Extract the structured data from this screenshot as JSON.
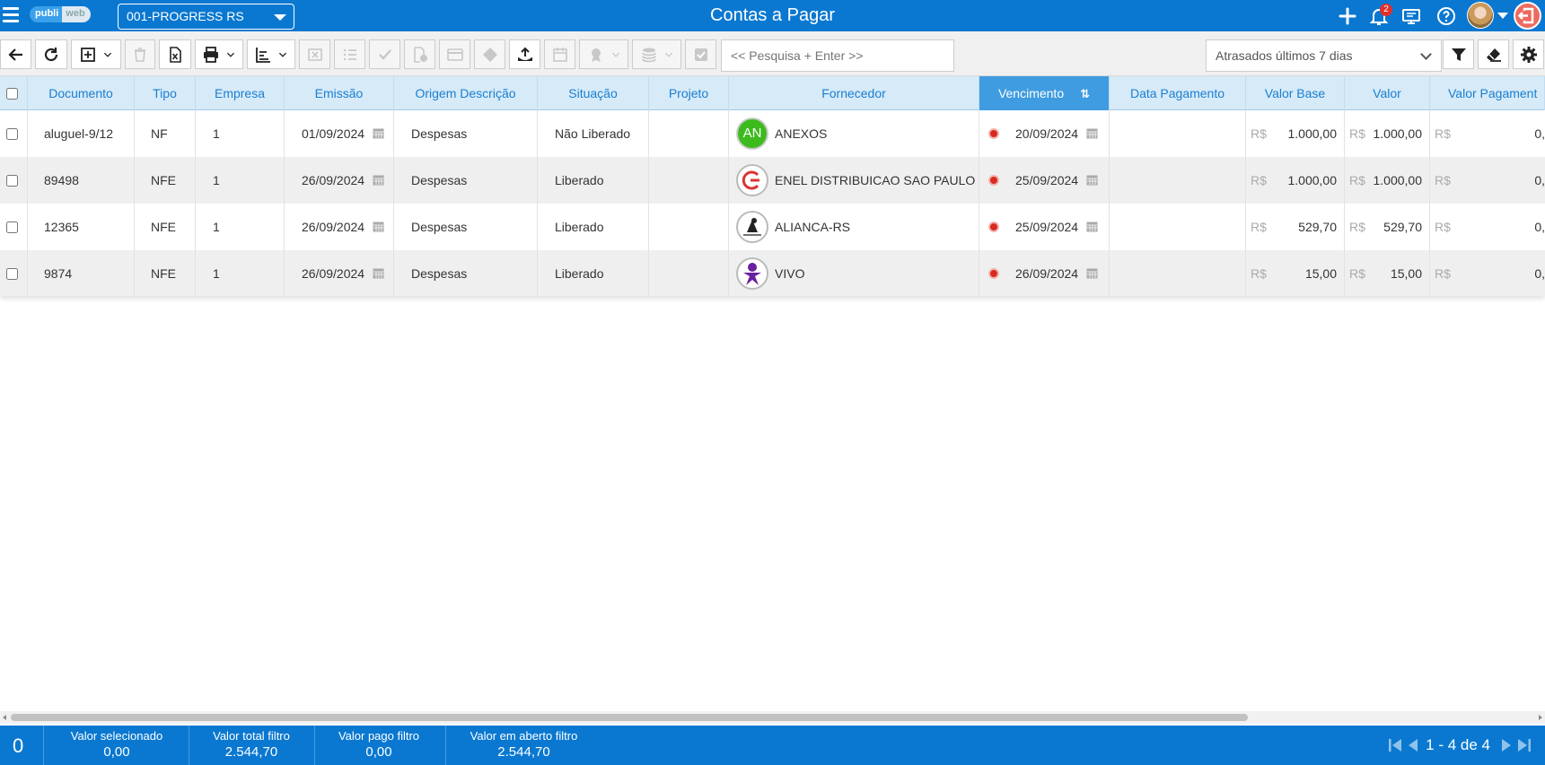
{
  "header": {
    "company": "001-PROGRESS RS",
    "title": "Contas a Pagar",
    "notification_count": "2",
    "logo": {
      "part1": "publi",
      "part2": "web"
    }
  },
  "toolbar": {
    "search_placeholder": "<< Pesquisa + Enter >>",
    "filter_value": "Atrasados últimos 7 dias"
  },
  "grid": {
    "columns": {
      "documento": "Documento",
      "tipo": "Tipo",
      "empresa": "Empresa",
      "emissao": "Emissão",
      "origem": "Origem Descrição",
      "situacao": "Situação",
      "projeto": "Projeto",
      "fornecedor": "Fornecedor",
      "vencimento": "Vencimento",
      "data_pagamento": "Data Pagamento",
      "valor_base": "Valor Base",
      "valor": "Valor",
      "valor_pagamento": "Valor Pagament"
    },
    "currency": "R$",
    "rows": [
      {
        "documento": "aluguel-9/12",
        "tipo": "NF",
        "empresa": "1",
        "emissao": "01/09/2024",
        "origem": "Despesas",
        "situacao": "Não Liberado",
        "projeto": "",
        "fornecedor_initials": "AN",
        "fornecedor": "ANEXOS",
        "vencimento": "20/09/2024",
        "data_pagamento": "",
        "valor_base": "1.000,00",
        "valor": "1.000,00",
        "valor_pagamento": "0,"
      },
      {
        "documento": "89498",
        "tipo": "NFE",
        "empresa": "1",
        "emissao": "26/09/2024",
        "origem": "Despesas",
        "situacao": "Liberado",
        "projeto": "",
        "fornecedor_initials": "",
        "fornecedor": "ENEL DISTRIBUICAO SAO PAULO",
        "vencimento": "25/09/2024",
        "data_pagamento": "",
        "valor_base": "1.000,00",
        "valor": "1.000,00",
        "valor_pagamento": "0,"
      },
      {
        "documento": "12365",
        "tipo": "NFE",
        "empresa": "1",
        "emissao": "26/09/2024",
        "origem": "Despesas",
        "situacao": "Liberado",
        "projeto": "",
        "fornecedor_initials": "",
        "fornecedor": "ALIANCA-RS",
        "vencimento": "25/09/2024",
        "data_pagamento": "",
        "valor_base": "529,70",
        "valor": "529,70",
        "valor_pagamento": "0,"
      },
      {
        "documento": "9874",
        "tipo": "NFE",
        "empresa": "1",
        "emissao": "26/09/2024",
        "origem": "Despesas",
        "situacao": "Liberado",
        "projeto": "",
        "fornecedor_initials": "",
        "fornecedor": "VIVO",
        "vencimento": "26/09/2024",
        "data_pagamento": "",
        "valor_base": "15,00",
        "valor": "15,00",
        "valor_pagamento": "0,"
      }
    ]
  },
  "footer": {
    "selected_count": "0",
    "valor_selecionado_label": "Valor selecionado",
    "valor_selecionado": "0,00",
    "valor_total_label": "Valor total filtro",
    "valor_total": "2.544,70",
    "valor_pago_label": "Valor pago filtro",
    "valor_pago": "0,00",
    "valor_aberto_label": "Valor em aberto filtro",
    "valor_aberto": "2.544,70",
    "pagination": "1 - 4 de 4"
  },
  "colors": {
    "primary": "#0a78d0",
    "header_row": "#d6eaf8",
    "active_column": "#3f9ce0",
    "overdue_dot": "#d72a20"
  }
}
